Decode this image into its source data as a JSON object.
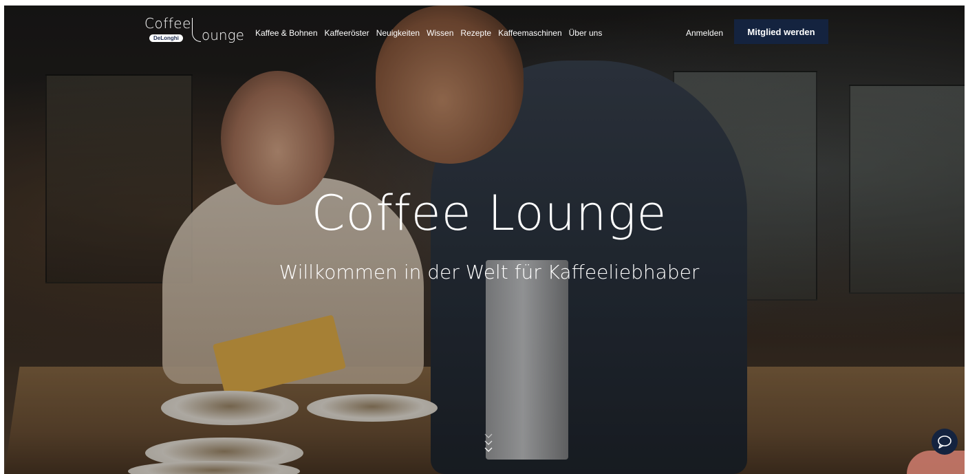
{
  "logo": {
    "coffee": "Coffee",
    "lounge": "ounge",
    "brand_badge": "DeLonghi"
  },
  "nav": {
    "items": [
      {
        "label": "Kaffee & Bohnen"
      },
      {
        "label": "Kaffeeröster"
      },
      {
        "label": "Neuigkeiten"
      },
      {
        "label": "Wissen"
      },
      {
        "label": "Rezepte"
      },
      {
        "label": "Kaffeemaschinen"
      },
      {
        "label": "Über uns"
      }
    ]
  },
  "header": {
    "login_label": "Anmelden",
    "cta_label": "Mitglied werden"
  },
  "hero": {
    "title": "Coffee Lounge",
    "subtitle": "Willkommen in der Welt für Kaffeeliebhaber"
  },
  "colors": {
    "cta_background": "#14233f",
    "text": "#ffffff"
  },
  "icons": {
    "scroll": "chevron-down-triple-icon",
    "chat": "chat-bubble-icon"
  }
}
